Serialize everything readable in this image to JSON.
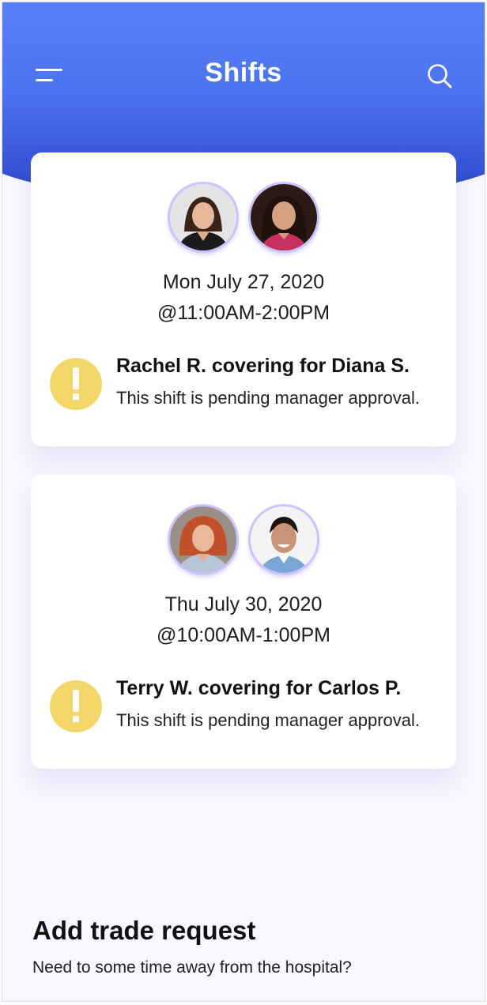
{
  "header": {
    "title": "Shifts",
    "menu_icon": "hamburger-menu-icon",
    "search_icon": "search-icon"
  },
  "shifts": [
    {
      "date": "Mon July 27, 2020",
      "time": "@11:00AM-2:00PM",
      "covering": "Rachel R. covering for Diana S.",
      "status": "This shift is pending manager approval.",
      "status_icon": "warning-icon"
    },
    {
      "date": "Thu July 30, 2020",
      "time": "@10:00AM-1:00PM",
      "covering": "Terry W. covering for Carlos P.",
      "status": "This shift is pending manager approval.",
      "status_icon": "warning-icon"
    }
  ],
  "add_trade": {
    "title": "Add trade request",
    "subtitle": "Need to some time away from the hospital?"
  },
  "colors": {
    "header_gradient_top": "#5a80f8",
    "header_gradient_bottom": "#1f36a6",
    "warning": "#f2d66a",
    "background": "#f7f7ff",
    "avatar_ring": "#c9c4ff"
  }
}
